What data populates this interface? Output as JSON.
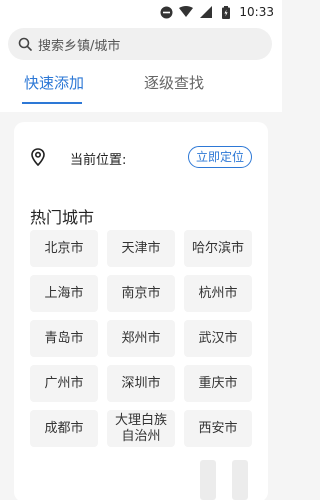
{
  "status_bar": {
    "time": "10:33"
  },
  "search": {
    "placeholder": "搜索乡镇/城市"
  },
  "tabs": [
    {
      "label": "快速添加"
    },
    {
      "label": "逐级查找"
    }
  ],
  "location": {
    "label": "当前位置:",
    "button": "立即定位"
  },
  "hot_cities": {
    "title": "热门城市",
    "items": [
      "北京市",
      "天津市",
      "哈尔滨市",
      "上海市",
      "南京市",
      "杭州市",
      "青岛市",
      "郑州市",
      "武汉市",
      "广州市",
      "深圳市",
      "重庆市",
      "成都市",
      "大理白族自治州",
      "西安市"
    ]
  },
  "colors": {
    "accent": "#2d78d6",
    "background": "#f5f5f5",
    "chip": "#f4f4f4"
  }
}
